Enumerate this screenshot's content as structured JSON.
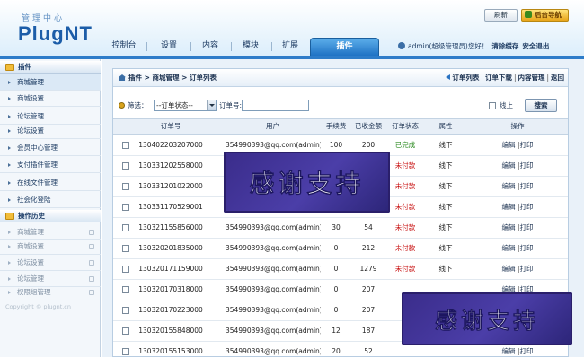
{
  "header": {
    "brand_cn": "管理中心",
    "brand": "PlugNT",
    "refresh_label": "刷新",
    "admin_label": "后台导航"
  },
  "nav": {
    "items": [
      "控制台",
      "设置",
      "内容",
      "模块",
      "扩展",
      "插件"
    ],
    "active": "插件",
    "user": "admin(超级管理员)",
    "greeting": "您好！",
    "clear_cache": "清除缓存",
    "logout": "安全退出"
  },
  "sidebar": {
    "section1_title": "插件",
    "items": [
      "商城管理",
      "商城设置",
      "论坛管理",
      "论坛设置",
      "会员中心管理",
      "支付插件管理",
      "在线文件管理",
      "社会化登陆"
    ],
    "section2_title": "操作历史",
    "history": [
      "商城管理",
      "商城设置",
      "论坛设置",
      "论坛管理",
      "权限组管理"
    ],
    "copyright": "Copyright © plugnt.cn"
  },
  "breadcrumb": {
    "path": "插件 > 商城管理 > 订单列表",
    "links": [
      "订单列表",
      "订单下载",
      "内容管理",
      "返回"
    ]
  },
  "filter": {
    "filter_label": "筛选：",
    "state_select": "--订单状态--",
    "order_label": "订单号:",
    "online_label": "线上",
    "search_label": "搜索"
  },
  "table": {
    "columns": [
      "订单号",
      "用户",
      "手续费",
      "已收金额",
      "订单状态",
      "属性",
      "操作"
    ],
    "edit_label": "编辑",
    "print_label": "打印",
    "rows": [
      {
        "id": "130402203207000",
        "user": "354990393@qq.com(admin)",
        "fee": "100",
        "received": "200",
        "status": "已完成",
        "status_type": "done",
        "attr": "线下"
      },
      {
        "id": "130331202558000",
        "user": "",
        "fee": "",
        "received": "",
        "status": "未付款",
        "status_type": "unpaid",
        "attr": "线下"
      },
      {
        "id": "130331201022000",
        "user": "",
        "fee": "",
        "received": "",
        "status": "未付款",
        "status_type": "unpaid",
        "attr": "线下"
      },
      {
        "id": "130331170529001",
        "user": "",
        "fee": "",
        "received": "",
        "status": "未付款",
        "status_type": "unpaid",
        "attr": "线下"
      },
      {
        "id": "130321155856000",
        "user": "354990393@qq.com(admin)",
        "fee": "30",
        "received": "54",
        "status": "未付款",
        "status_type": "unpaid",
        "attr": "线下"
      },
      {
        "id": "130320201835000",
        "user": "354990393@qq.com(admin)",
        "fee": "0",
        "received": "212",
        "status": "未付款",
        "status_type": "unpaid",
        "attr": "线下"
      },
      {
        "id": "130320171159000",
        "user": "354990393@qq.com(admin)",
        "fee": "0",
        "received": "1279",
        "status": "未付款",
        "status_type": "unpaid",
        "attr": "线下"
      },
      {
        "id": "130320170318000",
        "user": "354990393@qq.com(admin)",
        "fee": "0",
        "received": "207",
        "status": "",
        "status_type": "",
        "attr": ""
      },
      {
        "id": "130320170223000",
        "user": "354990393@qq.com(admin)",
        "fee": "0",
        "received": "207",
        "status": "",
        "status_type": "",
        "attr": ""
      },
      {
        "id": "130320155848000",
        "user": "354990393@qq.com(admin)",
        "fee": "12",
        "received": "187",
        "status": "",
        "status_type": "",
        "attr": ""
      },
      {
        "id": "130320155153000",
        "user": "354990393@qq.com(admin)",
        "fee": "20",
        "received": "52",
        "status": "",
        "status_type": "",
        "attr": ""
      }
    ]
  },
  "watermark": {
    "text1": "感谢支持",
    "text2": "感谢支持"
  },
  "colors": {
    "brand": "#1c5da8",
    "nav_active": "#2d7cc9",
    "status_done": "#2a8a1f",
    "status_unpaid": "#c81010",
    "watermark_bg": "#3a2c8a"
  }
}
